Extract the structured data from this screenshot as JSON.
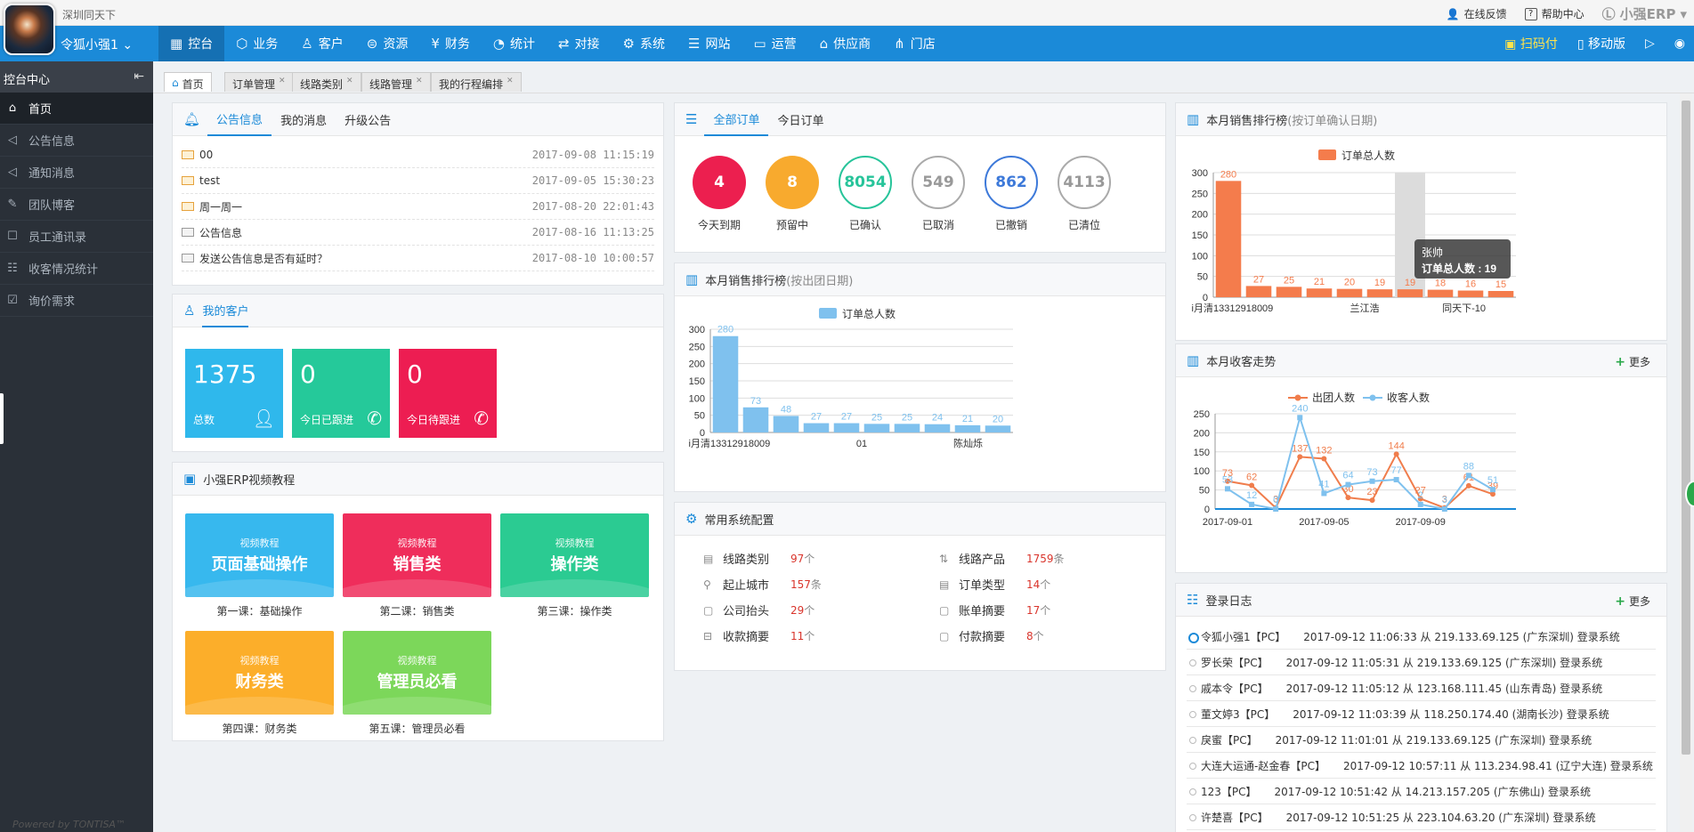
{
  "header": {
    "company": "深圳同天下",
    "feedback": "在线反馈",
    "help": "帮助中心",
    "brand": "小强ERP",
    "user": "令狐小强1 ⌄",
    "nav": [
      "控台",
      "业务",
      "客户",
      "资源",
      "财务",
      "统计",
      "对接",
      "系统",
      "网站",
      "运营",
      "供应商",
      "门店"
    ],
    "nav_active": 0,
    "pay": "扫码付",
    "mobile": "移动版"
  },
  "sidebar": {
    "title": "控台中心",
    "items": [
      "首页",
      "公告信息",
      "通知消息",
      "团队博客",
      "员工通讯录",
      "收客情况统计",
      "询价需求"
    ],
    "powered": "Powered by TONTISA™"
  },
  "tabs": [
    "首页",
    "订单管理",
    "线路类别",
    "线路管理",
    "我的行程编排"
  ],
  "notice": {
    "tabs": [
      "公告信息",
      "我的消息",
      "升级公告"
    ],
    "rows": [
      {
        "title": "00",
        "date": "2017-09-08 11:15:19"
      },
      {
        "title": "test",
        "date": "2017-09-05 15:30:23"
      },
      {
        "title": "周一周一",
        "date": "2017-08-20 22:01:43"
      },
      {
        "title": "公告信息",
        "date": "2017-08-16 11:13:25"
      },
      {
        "title": "发送公告信息是否有延时？",
        "date": "2017-08-10 10:00:57"
      }
    ]
  },
  "customers": {
    "title": "我的客户",
    "cards": [
      {
        "num": "1375",
        "label": "总数",
        "color": "#2fb8ec"
      },
      {
        "num": "0",
        "label": "今日已跟进",
        "color": "#25c99a"
      },
      {
        "num": "0",
        "label": "今日待跟进",
        "color": "#ed1d52"
      }
    ]
  },
  "videos": {
    "title": "小强ERP视频教程",
    "items": [
      {
        "sub": "视频教程",
        "big": "页面基础操作",
        "caption": "第一课：基础操作",
        "color": "#37b8ee"
      },
      {
        "sub": "视频教程",
        "big": "销售类",
        "caption": "第二课：销售类",
        "color": "#ef2d5b"
      },
      {
        "sub": "视频教程",
        "big": "操作类",
        "caption": "第三课：操作类",
        "color": "#2bcb92"
      },
      {
        "sub": "视频教程",
        "big": "财务类",
        "caption": "第四课：财务类",
        "color": "#fcae2a"
      },
      {
        "sub": "视频教程",
        "big": "管理员必看",
        "caption": "第五课：管理员必看",
        "color": "#7cd75a"
      }
    ]
  },
  "orders": {
    "tabs": [
      "全部订单",
      "今日订单"
    ],
    "stats": [
      {
        "num": "4",
        "label": "今天到期",
        "color": "#ec1f4f",
        "filled": true
      },
      {
        "num": "8",
        "label": "预留中",
        "color": "#f8aa2e",
        "filled": true
      },
      {
        "num": "8054",
        "label": "已确认",
        "color": "#27c49a",
        "filled": false
      },
      {
        "num": "549",
        "label": "已取消",
        "color": "#999999",
        "filled": false
      },
      {
        "num": "862",
        "label": "已撤销",
        "color": "#3d79d9",
        "filled": false
      },
      {
        "num": "4113",
        "label": "已清位",
        "color": "#999999",
        "filled": false
      }
    ]
  },
  "rank_depart": {
    "title": "本月销售排行榜",
    "sub": "(按出团日期)"
  },
  "config": {
    "title": "常用系统配置",
    "items": [
      {
        "k": "线路类别",
        "v": "97",
        "u": "个",
        "icon": "▤"
      },
      {
        "k": "线路产品",
        "v": "1759",
        "u": "条",
        "icon": "⇅"
      },
      {
        "k": "起止城市",
        "v": "157",
        "u": "条",
        "icon": "⚲"
      },
      {
        "k": "订单类型",
        "v": "14",
        "u": "个",
        "icon": "▤"
      },
      {
        "k": "公司抬头",
        "v": "29",
        "u": "个",
        "icon": "▢"
      },
      {
        "k": "账单摘要",
        "v": "17",
        "u": "个",
        "icon": "▢"
      },
      {
        "k": "收款摘要",
        "v": "11",
        "u": "个",
        "icon": "⊟"
      },
      {
        "k": "付款摘要",
        "v": "8",
        "u": "个",
        "icon": "▢"
      }
    ]
  },
  "rank_confirm": {
    "title": "本月销售排行榜",
    "sub": "(按订单确认日期)"
  },
  "trend": {
    "title": "本月收客走势",
    "more": "更多"
  },
  "loginlog": {
    "title": "登录日志",
    "more": "更多",
    "rows": [
      {
        "name": "令狐小强1【PC】",
        "info": "2017-09-12 11:06:33 从 219.133.69.125 (广东深圳) 登录系统"
      },
      {
        "name": "罗长荣【PC】",
        "info": "2017-09-12 11:05:31 从 219.133.69.125 (广东深圳) 登录系统"
      },
      {
        "name": "戚本令【PC】",
        "info": "2017-09-12 11:05:12 从 123.168.111.45 (山东青岛) 登录系统"
      },
      {
        "name": "董文婷3【PC】",
        "info": "2017-09-12 11:03:39 从 118.250.174.40 (湖南长沙) 登录系统"
      },
      {
        "name": "戾蜜【PC】",
        "info": "2017-09-12 11:01:01 从 219.133.69.125 (广东深圳) 登录系统"
      },
      {
        "name": "大连大运通-赵金春【PC】",
        "info": "2017-09-12 10:57:11 从 113.234.98.41 (辽宁大连) 登录系统"
      },
      {
        "name": "123【PC】",
        "info": "2017-09-12 10:51:42 从 14.213.157.205 (广东佛山) 登录系统"
      },
      {
        "name": "许楚喜【PC】",
        "info": "2017-09-12 10:51:25 从 223.104.63.20 (广东深圳) 登录系统"
      }
    ]
  },
  "chart_data": [
    {
      "type": "bar",
      "legend": [
        "订单总人数"
      ],
      "ylim": [
        0,
        300
      ],
      "yticks": [
        0,
        50,
        100,
        150,
        200,
        250,
        300
      ],
      "values": [
        280,
        73,
        48,
        27,
        27,
        25,
        25,
        24,
        21,
        20
      ],
      "xticklabels": [
        "i月清",
        "13312918009",
        "01",
        "陈灿烁"
      ],
      "color": "#7fc1ee"
    },
    {
      "type": "bar",
      "legend": [
        "订单总人数"
      ],
      "ylim": [
        0,
        300
      ],
      "yticks": [
        0,
        50,
        100,
        150,
        200,
        250,
        300
      ],
      "values": [
        280,
        27,
        25,
        21,
        20,
        19,
        19,
        18,
        16,
        15
      ],
      "xticklabels": [
        "i月清",
        "13312918009",
        "兰江浩",
        "同天下-10"
      ],
      "color": "#f47c4c",
      "tooltip": {
        "name": "张帅",
        "text": "订单总人数 : 19"
      }
    },
    {
      "type": "line",
      "legend": [
        "出团人数",
        "收客人数"
      ],
      "ylim": [
        0,
        250
      ],
      "yticks": [
        0,
        50,
        100,
        150,
        200,
        250
      ],
      "xticklabels": [
        "2017-09-01",
        "2017-09-05",
        "2017-09-09"
      ],
      "series": [
        {
          "name": "出团人数",
          "color": "#f07d4c",
          "values": [
            73,
            62,
            3,
            137,
            132,
            30,
            23,
            144,
            27,
            3,
            61,
            39
          ],
          "labels": [
            "73",
            "62",
            "3",
            "137",
            "132",
            "30",
            "23",
            "144",
            "27",
            "3",
            "61",
            "39"
          ]
        },
        {
          "name": "收客人数",
          "color": "#7fc1ee",
          "values": [
            53,
            12,
            0,
            240,
            41,
            64,
            73,
            77,
            12,
            0,
            88,
            51
          ],
          "labels": [
            "53",
            "12",
            "0",
            "240",
            "41",
            "64",
            "73",
            "77",
            "2",
            "3",
            "88",
            "51"
          ]
        }
      ]
    }
  ]
}
